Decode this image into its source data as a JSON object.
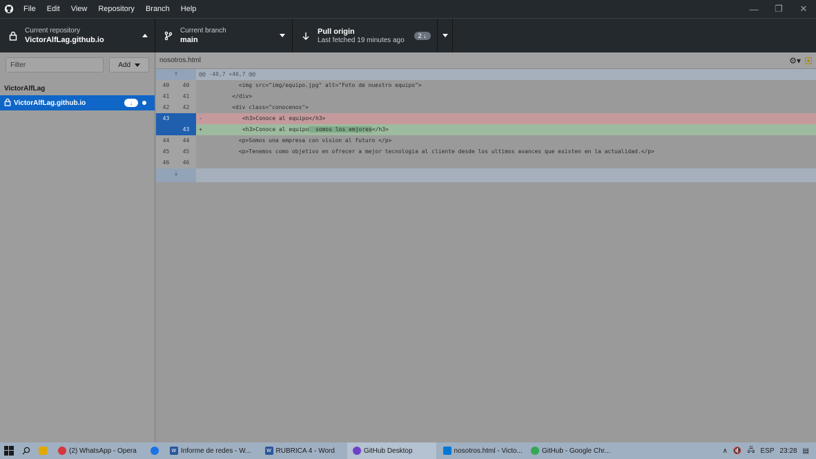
{
  "menubar": {
    "items": [
      "File",
      "Edit",
      "View",
      "Repository",
      "Branch",
      "Help"
    ]
  },
  "toolbar": {
    "repo_label": "Current repository",
    "repo_value": "VictorAlfLag.github.io",
    "branch_label": "Current branch",
    "branch_value": "main",
    "pull_label": "Pull origin",
    "pull_sub": "Last fetched 19 minutes ago",
    "pull_badge": "2 ↓"
  },
  "sidebar": {
    "filter_placeholder": "Filter",
    "add_label": "Add",
    "group_title": "VictorAlfLag",
    "repo_item": "VictorAlfLag.github.io"
  },
  "diff": {
    "filename": "nosotros.html",
    "hunk_header": "@@ -40,7 +40,7 @@",
    "lines": [
      {
        "old": "40",
        "new": "40",
        "text": "            <img src=\"img/equipo.jpg\" alt=\"Foto de nuestro equipo\">"
      },
      {
        "old": "41",
        "new": "41",
        "text": "          </div>"
      },
      {
        "old": "42",
        "new": "42",
        "text": "          <div class=\"conocenos\">"
      },
      {
        "old": "43",
        "new": "",
        "sign": "-",
        "text": "           <h3>Conoce al equipo</h3>"
      },
      {
        "old": "",
        "new": "43",
        "sign": "+",
        "text_before": "           <h3>Conoce al equipo",
        "text_hl": "  somos los emjores",
        "text_after": "</h3>"
      },
      {
        "old": "44",
        "new": "44",
        "text": "            <p>Somos una empresa con vision al futuro </p>"
      },
      {
        "old": "45",
        "new": "45",
        "text": "            <p>Tenemos como objetivo en ofrecer a mejor tecnologia al cliente desde los ultimos avances que existen en la actualidad.</p>"
      },
      {
        "old": "46",
        "new": "46",
        "text": ""
      }
    ]
  },
  "taskbar": {
    "items": [
      "(2) WhatsApp - Opera",
      "Informe de redes - W...",
      "RUBRICA 4 - Word",
      "GitHub Desktop",
      "nosotros.html - Victo...",
      "GitHub - Google Chr..."
    ],
    "lang": "ESP",
    "time": "23:28"
  }
}
